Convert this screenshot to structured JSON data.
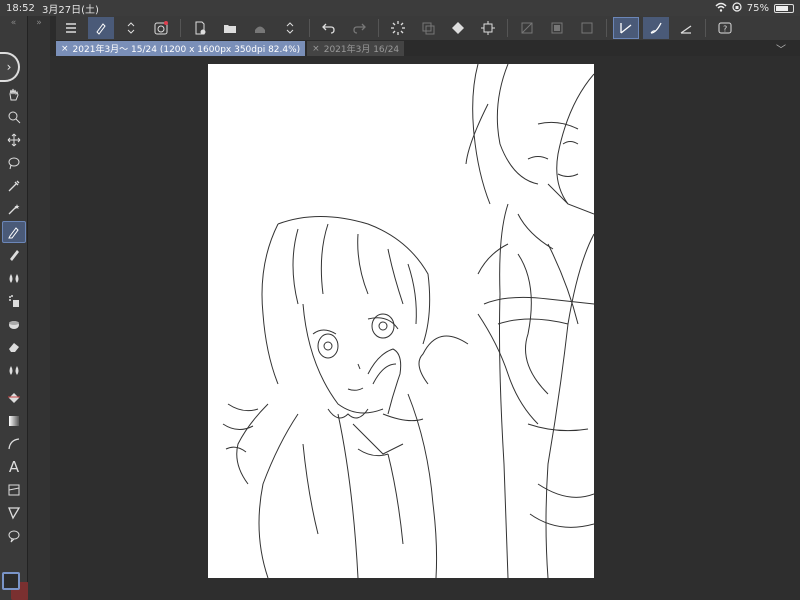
{
  "status": {
    "time": "18:52",
    "date": "3月27日(土)",
    "battery": "75%",
    "battery_level": 0.75
  },
  "tabs": [
    {
      "label": "2021年3月～ 15/24 (1200 x 1600px 350dpi 82.4%)",
      "active": true
    },
    {
      "label": "2021年3月 16/24",
      "active": false
    }
  ],
  "icons": {
    "left_tools": [
      "hand-icon",
      "zoom-select-icon",
      "move-icon",
      "lasso-icon",
      "eyedropper-icon",
      "magic-wand-icon",
      "pen-icon",
      "pencil-icon",
      "brush-icon",
      "airbrush-icon",
      "decoration-icon",
      "eraser-icon",
      "blend-icon",
      "fill-icon",
      "gradient-icon",
      "curve-icon",
      "text-icon",
      "frame-icon",
      "ruler-icon",
      "balloon-icon"
    ],
    "toolbar": [
      "menu-icon",
      "pen-tool-icon",
      "stepper-icon",
      "quick-access-icon",
      "new-file-icon",
      "open-file-icon",
      "save-icon",
      "stepper-icon",
      "undo-icon",
      "redo-icon",
      "loading-icon",
      "layer-copy-icon",
      "fill-layer-icon",
      "crop-icon",
      "no-snap-icon",
      "snap-ruler-icon",
      "snap-grid-icon",
      "pen-snap-icon",
      "brush-snap-icon",
      "line-snap-icon",
      "help-icon"
    ]
  },
  "colors": {
    "accent": "#6b86b8",
    "main_color": "#2b2b2b",
    "sub_color": "#7a3030"
  }
}
